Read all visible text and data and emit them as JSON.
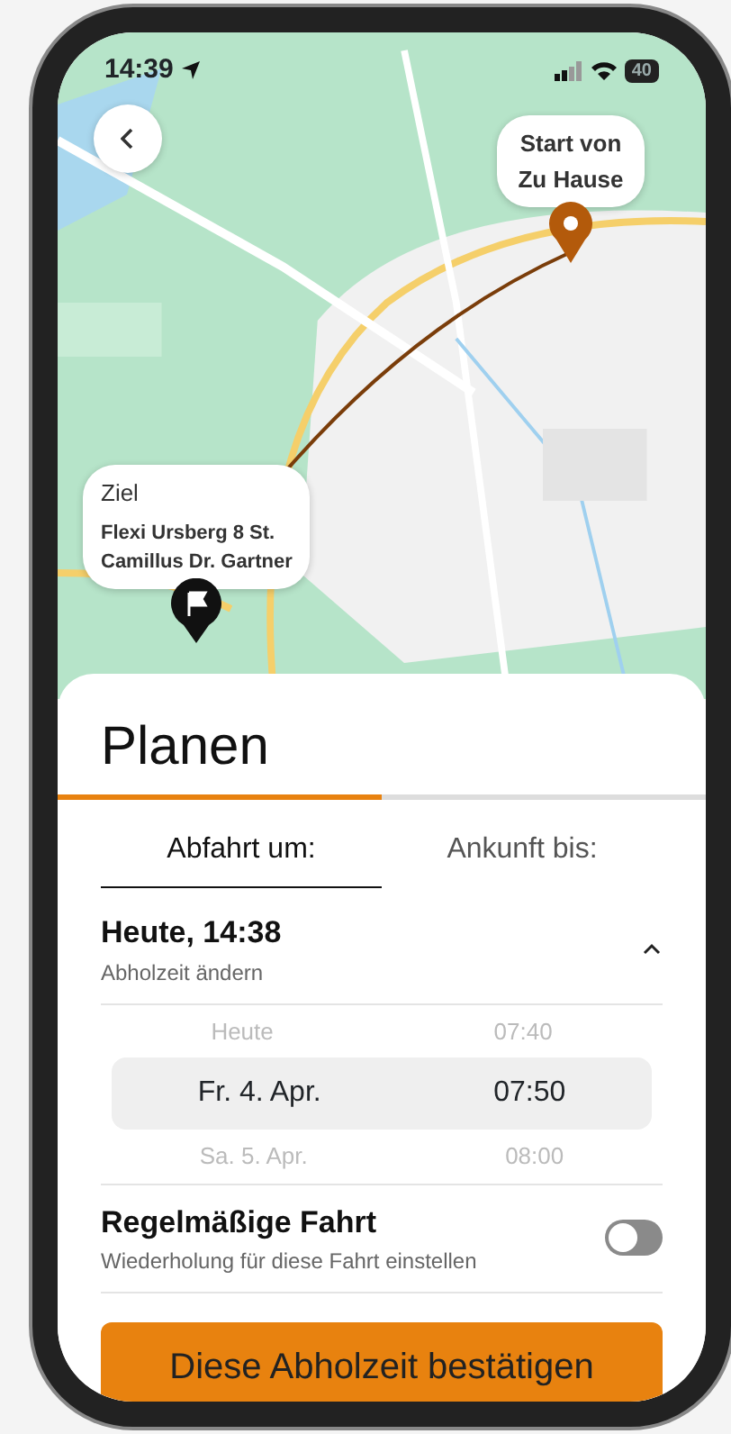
{
  "status_bar": {
    "time": "14:39",
    "battery": "40"
  },
  "map": {
    "kind": "picture",
    "start_callout": "Start von Zu Hause",
    "destination_callout": {
      "title": "Ziel",
      "address_lines": [
        "Flexi Ursberg 8 St.",
        "Camillus Dr. Gartner"
      ]
    }
  },
  "sheet": {
    "title": "Planen",
    "progress": {
      "level": 0.5
    },
    "tabs": [
      {
        "label": "Abfahrt um:",
        "selected": true
      },
      {
        "label": "Ankunft bis:",
        "selected": false
      }
    ],
    "pickup": {
      "title": "Heute, 14:38",
      "subtitle": "Abholzeit ändern",
      "expanded": true
    },
    "picker_rows": [
      {
        "date": "Heute",
        "time": "07:40",
        "selected": false
      },
      {
        "date": "Fr. 4. Apr.",
        "time": "07:50",
        "selected": true
      },
      {
        "date": "Sa. 5. Apr.",
        "time": "08:00",
        "selected": false
      }
    ],
    "recurring": {
      "title": "Regelmäßige Fahrt",
      "subtitle": "Wiederholung für diese Fahrt einstellen",
      "on": false
    },
    "confirm_button": "Diese Abholzeit bestätigen"
  }
}
